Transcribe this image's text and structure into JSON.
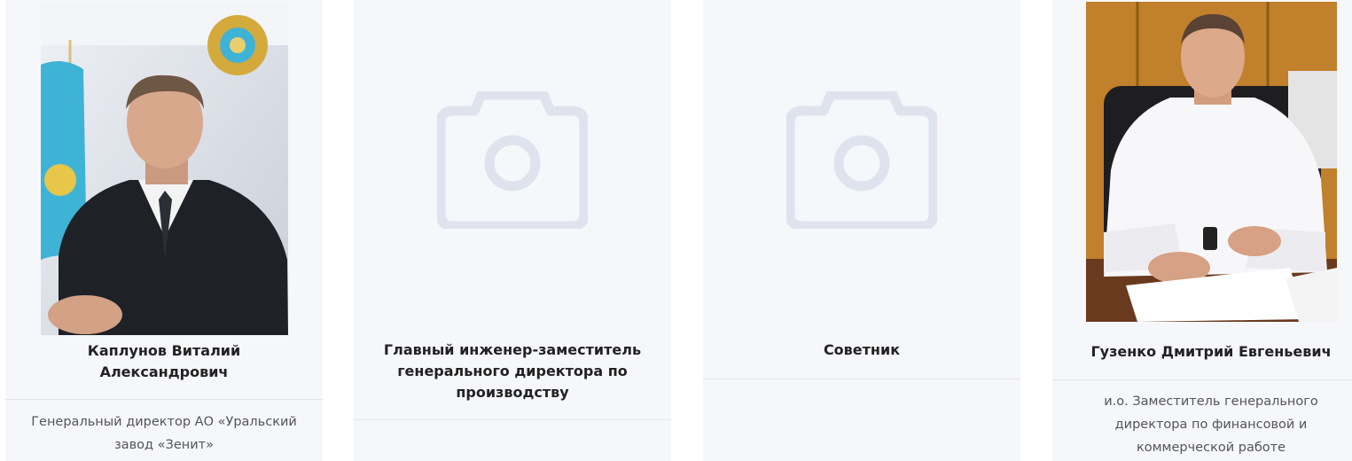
{
  "cards": [
    {
      "photo": "portrait-man-dark-sweater-kazakh-flag",
      "name": "Каплунов Виталий Александрович",
      "description": "Генеральный директор АО «Уральский завод «Зенит»"
    },
    {
      "photo": "camera-icon",
      "name": "Главный инженер-заместитель генерального директора по производству",
      "description": ""
    },
    {
      "photo": "camera-icon",
      "name": "Советник",
      "description": ""
    },
    {
      "photo": "portrait-man-white-shirt-office",
      "name": "Гузенко Дмитрий Евгеньевич",
      "description": "и.о. Заместитель генерального директора по финансовой и коммерческой работе"
    }
  ],
  "colors": {
    "card_bg": "#f6f7fb",
    "placeholder_icon": "#dfe3ee",
    "flag_blue": "#3fb3d6",
    "emblem_gold": "#d4aa3c"
  }
}
